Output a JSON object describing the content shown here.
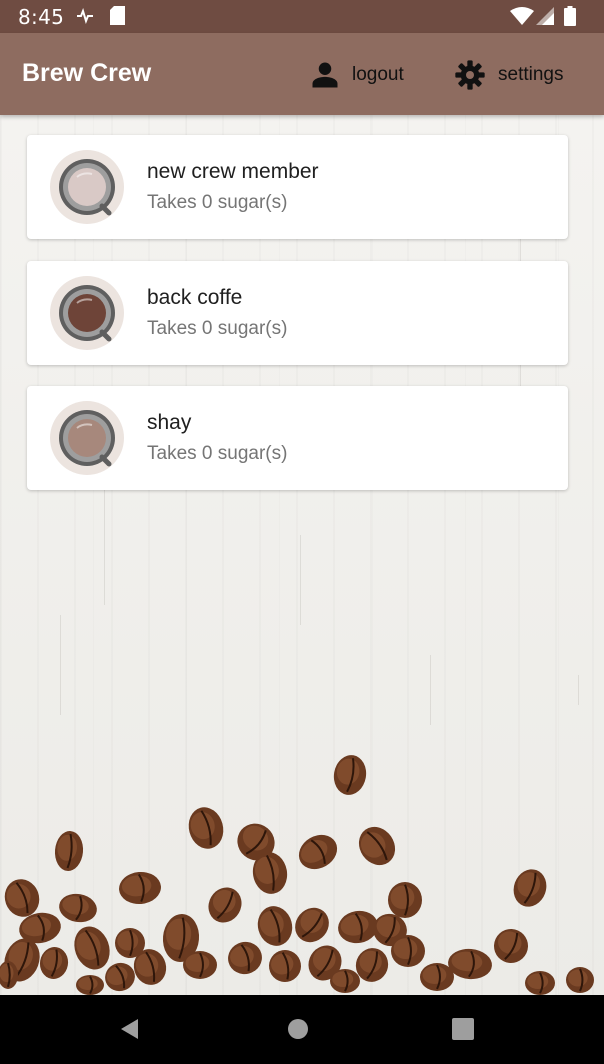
{
  "status_bar": {
    "time": "8:45"
  },
  "app_bar": {
    "title": "Brew Crew",
    "logout_label": "logout",
    "settings_label": "settings"
  },
  "crew": [
    {
      "name": "new crew member",
      "subtitle": "Takes 0 sugar(s)",
      "coffee_color": "#d9c9c6"
    },
    {
      "name": "back coffe",
      "subtitle": "Takes 0 sugar(s)",
      "coffee_color": "#6e4438"
    },
    {
      "name": "shay",
      "subtitle": "Takes 0 sugar(s)",
      "coffee_color": "#a7887c"
    }
  ],
  "colors": {
    "status_bar": "#6f4c42",
    "app_bar": "#8e6c60",
    "nav_bar": "#000000"
  },
  "icons": {
    "status": [
      "activity-icon",
      "sd-card-icon",
      "wifi-icon",
      "signal-icon",
      "battery-icon"
    ],
    "actions": [
      "person-icon",
      "gear-icon"
    ],
    "nav": [
      "back-icon",
      "home-icon",
      "recents-icon"
    ]
  }
}
